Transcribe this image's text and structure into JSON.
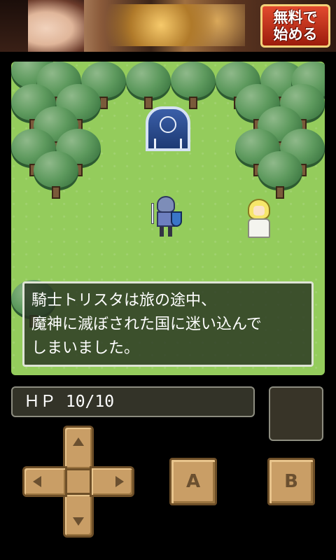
{
  "ad": {
    "cta_line1": "無料で",
    "cta_line2": "始める"
  },
  "dialog": {
    "line1": "騎士トリスタは旅の途中、",
    "line2": "魔神に滅ぼされた国に迷い込んで",
    "line3": "しまいました。"
  },
  "hud": {
    "hp_text": "ＨＰ 10/10"
  },
  "controls": {
    "a_label": "A",
    "b_label": "B"
  },
  "icons": [
    "arrow-up-icon",
    "arrow-down-icon",
    "arrow-left-icon",
    "arrow-right-icon"
  ],
  "colors": {
    "grass": "#94cc5c",
    "tree": "#5e9a5e",
    "button": "#c99e66",
    "dialog_bg": "#283422"
  }
}
